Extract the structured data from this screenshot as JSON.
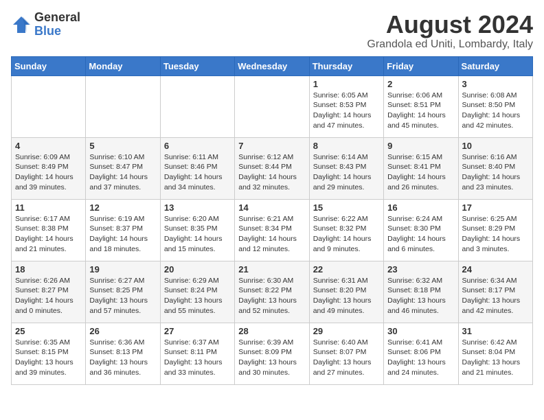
{
  "header": {
    "logo_general": "General",
    "logo_blue": "Blue",
    "month_title": "August 2024",
    "location": "Grandola ed Uniti, Lombardy, Italy"
  },
  "days_of_week": [
    "Sunday",
    "Monday",
    "Tuesday",
    "Wednesday",
    "Thursday",
    "Friday",
    "Saturday"
  ],
  "weeks": [
    [
      {
        "day": "",
        "detail": ""
      },
      {
        "day": "",
        "detail": ""
      },
      {
        "day": "",
        "detail": ""
      },
      {
        "day": "",
        "detail": ""
      },
      {
        "day": "1",
        "detail": "Sunrise: 6:05 AM\nSunset: 8:53 PM\nDaylight: 14 hours\nand 47 minutes."
      },
      {
        "day": "2",
        "detail": "Sunrise: 6:06 AM\nSunset: 8:51 PM\nDaylight: 14 hours\nand 45 minutes."
      },
      {
        "day": "3",
        "detail": "Sunrise: 6:08 AM\nSunset: 8:50 PM\nDaylight: 14 hours\nand 42 minutes."
      }
    ],
    [
      {
        "day": "4",
        "detail": "Sunrise: 6:09 AM\nSunset: 8:49 PM\nDaylight: 14 hours\nand 39 minutes."
      },
      {
        "day": "5",
        "detail": "Sunrise: 6:10 AM\nSunset: 8:47 PM\nDaylight: 14 hours\nand 37 minutes."
      },
      {
        "day": "6",
        "detail": "Sunrise: 6:11 AM\nSunset: 8:46 PM\nDaylight: 14 hours\nand 34 minutes."
      },
      {
        "day": "7",
        "detail": "Sunrise: 6:12 AM\nSunset: 8:44 PM\nDaylight: 14 hours\nand 32 minutes."
      },
      {
        "day": "8",
        "detail": "Sunrise: 6:14 AM\nSunset: 8:43 PM\nDaylight: 14 hours\nand 29 minutes."
      },
      {
        "day": "9",
        "detail": "Sunrise: 6:15 AM\nSunset: 8:41 PM\nDaylight: 14 hours\nand 26 minutes."
      },
      {
        "day": "10",
        "detail": "Sunrise: 6:16 AM\nSunset: 8:40 PM\nDaylight: 14 hours\nand 23 minutes."
      }
    ],
    [
      {
        "day": "11",
        "detail": "Sunrise: 6:17 AM\nSunset: 8:38 PM\nDaylight: 14 hours\nand 21 minutes."
      },
      {
        "day": "12",
        "detail": "Sunrise: 6:19 AM\nSunset: 8:37 PM\nDaylight: 14 hours\nand 18 minutes."
      },
      {
        "day": "13",
        "detail": "Sunrise: 6:20 AM\nSunset: 8:35 PM\nDaylight: 14 hours\nand 15 minutes."
      },
      {
        "day": "14",
        "detail": "Sunrise: 6:21 AM\nSunset: 8:34 PM\nDaylight: 14 hours\nand 12 minutes."
      },
      {
        "day": "15",
        "detail": "Sunrise: 6:22 AM\nSunset: 8:32 PM\nDaylight: 14 hours\nand 9 minutes."
      },
      {
        "day": "16",
        "detail": "Sunrise: 6:24 AM\nSunset: 8:30 PM\nDaylight: 14 hours\nand 6 minutes."
      },
      {
        "day": "17",
        "detail": "Sunrise: 6:25 AM\nSunset: 8:29 PM\nDaylight: 14 hours\nand 3 minutes."
      }
    ],
    [
      {
        "day": "18",
        "detail": "Sunrise: 6:26 AM\nSunset: 8:27 PM\nDaylight: 14 hours\nand 0 minutes."
      },
      {
        "day": "19",
        "detail": "Sunrise: 6:27 AM\nSunset: 8:25 PM\nDaylight: 13 hours\nand 57 minutes."
      },
      {
        "day": "20",
        "detail": "Sunrise: 6:29 AM\nSunset: 8:24 PM\nDaylight: 13 hours\nand 55 minutes."
      },
      {
        "day": "21",
        "detail": "Sunrise: 6:30 AM\nSunset: 8:22 PM\nDaylight: 13 hours\nand 52 minutes."
      },
      {
        "day": "22",
        "detail": "Sunrise: 6:31 AM\nSunset: 8:20 PM\nDaylight: 13 hours\nand 49 minutes."
      },
      {
        "day": "23",
        "detail": "Sunrise: 6:32 AM\nSunset: 8:18 PM\nDaylight: 13 hours\nand 46 minutes."
      },
      {
        "day": "24",
        "detail": "Sunrise: 6:34 AM\nSunset: 8:17 PM\nDaylight: 13 hours\nand 42 minutes."
      }
    ],
    [
      {
        "day": "25",
        "detail": "Sunrise: 6:35 AM\nSunset: 8:15 PM\nDaylight: 13 hours\nand 39 minutes."
      },
      {
        "day": "26",
        "detail": "Sunrise: 6:36 AM\nSunset: 8:13 PM\nDaylight: 13 hours\nand 36 minutes."
      },
      {
        "day": "27",
        "detail": "Sunrise: 6:37 AM\nSunset: 8:11 PM\nDaylight: 13 hours\nand 33 minutes."
      },
      {
        "day": "28",
        "detail": "Sunrise: 6:39 AM\nSunset: 8:09 PM\nDaylight: 13 hours\nand 30 minutes."
      },
      {
        "day": "29",
        "detail": "Sunrise: 6:40 AM\nSunset: 8:07 PM\nDaylight: 13 hours\nand 27 minutes."
      },
      {
        "day": "30",
        "detail": "Sunrise: 6:41 AM\nSunset: 8:06 PM\nDaylight: 13 hours\nand 24 minutes."
      },
      {
        "day": "31",
        "detail": "Sunrise: 6:42 AM\nSunset: 8:04 PM\nDaylight: 13 hours\nand 21 minutes."
      }
    ]
  ]
}
